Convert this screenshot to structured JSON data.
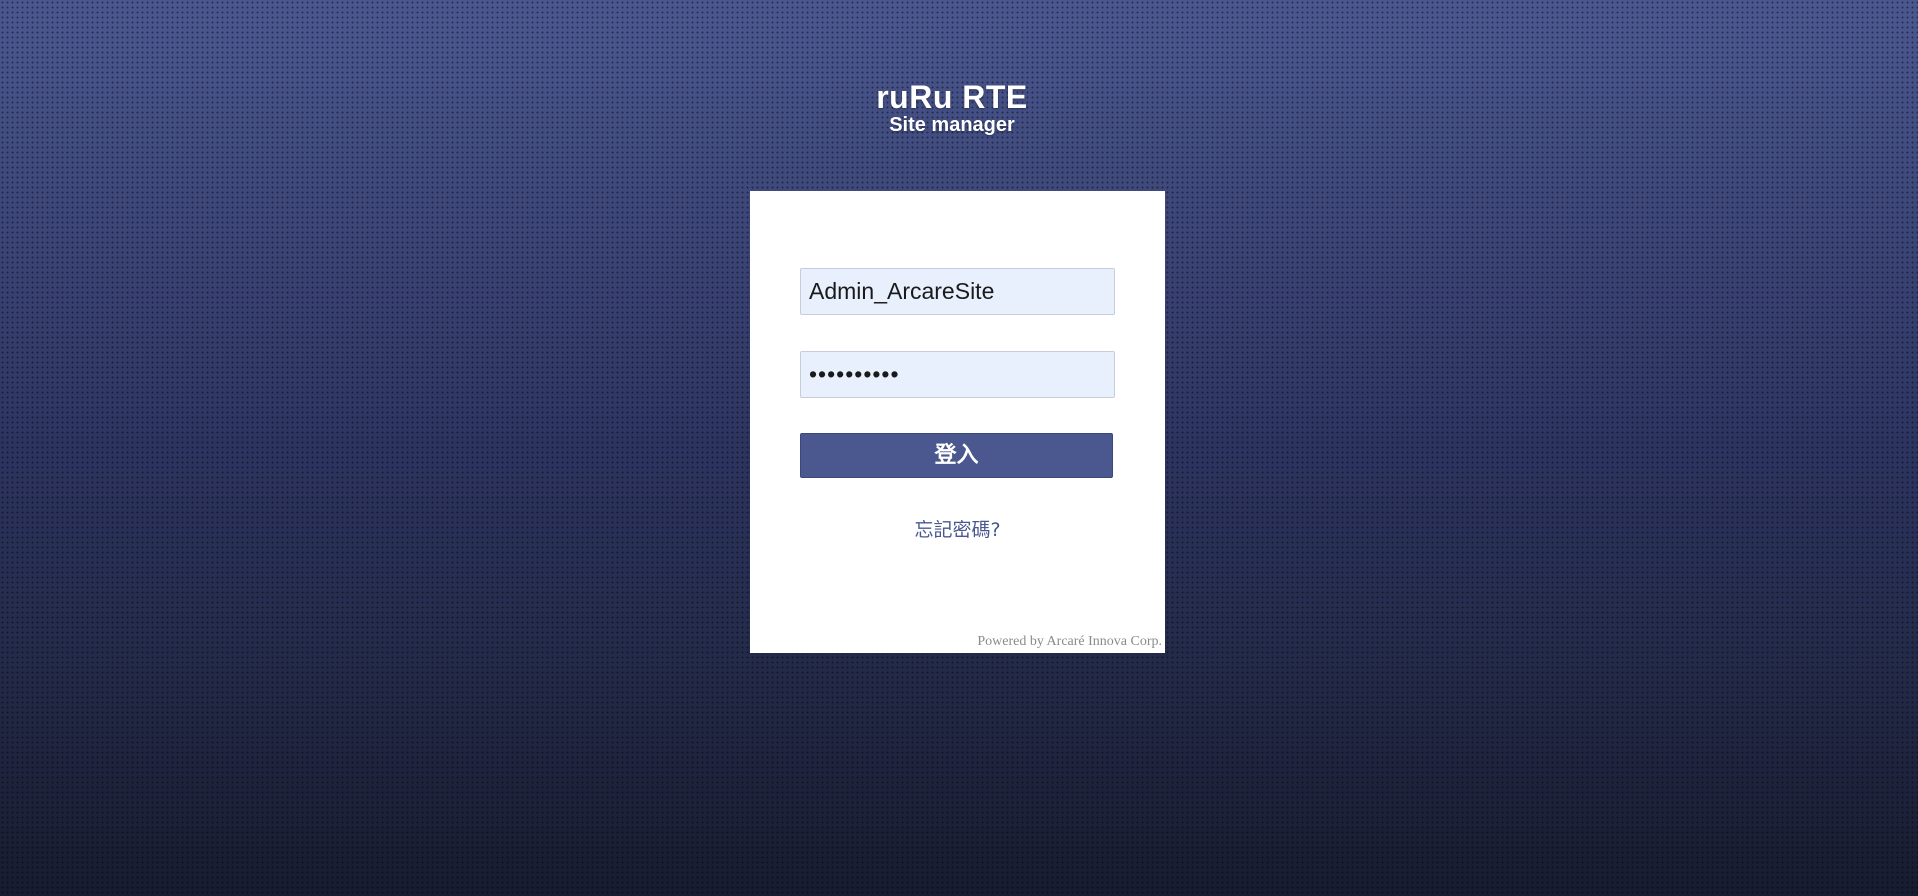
{
  "brand": {
    "title": "ruRu RTE",
    "subtitle": "Site manager"
  },
  "login": {
    "username_value": "Admin_ArcareSite",
    "password_value": "••••••••••",
    "submit_label": "登入",
    "forgot_label": "忘記密碼?",
    "powered_by": "Powered by Arcaré Innova Corp."
  },
  "colors": {
    "accent": "#4b5890",
    "background_top": "#4b5890",
    "background_bottom": "#181c30",
    "input_fill": "#e8f0fe",
    "card": "#ffffff"
  }
}
